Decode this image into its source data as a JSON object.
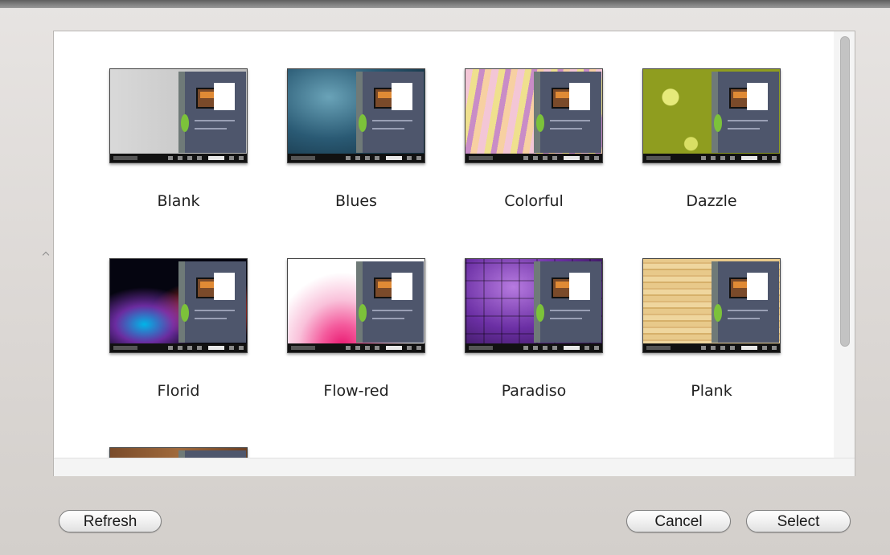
{
  "templates": [
    {
      "label": "Blank"
    },
    {
      "label": "Blues"
    },
    {
      "label": "Colorful"
    },
    {
      "label": "Dazzle"
    },
    {
      "label": "Florid"
    },
    {
      "label": "Flow-red"
    },
    {
      "label": "Paradiso"
    },
    {
      "label": "Plank"
    },
    {
      "label": ""
    }
  ],
  "buttons": {
    "refresh": "Refresh",
    "cancel": "Cancel",
    "select": "Select"
  },
  "colors": {
    "page": "#4e566c",
    "spine": "#6f7a78",
    "leaf": "#7cc23a",
    "toolbar": "#111111"
  }
}
